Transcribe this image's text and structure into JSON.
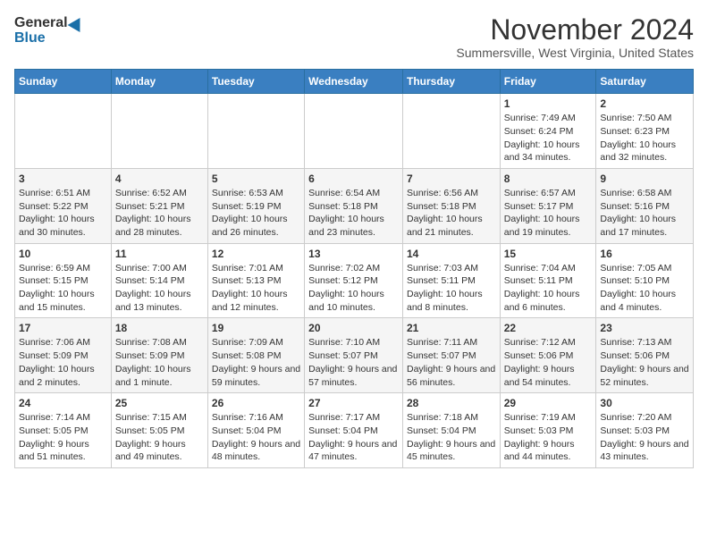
{
  "logo": {
    "general": "General",
    "blue": "Blue"
  },
  "title": "November 2024",
  "subtitle": "Summersville, West Virginia, United States",
  "weekdays": [
    "Sunday",
    "Monday",
    "Tuesday",
    "Wednesday",
    "Thursday",
    "Friday",
    "Saturday"
  ],
  "weeks": [
    [
      {
        "day": "",
        "info": ""
      },
      {
        "day": "",
        "info": ""
      },
      {
        "day": "",
        "info": ""
      },
      {
        "day": "",
        "info": ""
      },
      {
        "day": "",
        "info": ""
      },
      {
        "day": "1",
        "info": "Sunrise: 7:49 AM\nSunset: 6:24 PM\nDaylight: 10 hours and 34 minutes."
      },
      {
        "day": "2",
        "info": "Sunrise: 7:50 AM\nSunset: 6:23 PM\nDaylight: 10 hours and 32 minutes."
      }
    ],
    [
      {
        "day": "3",
        "info": "Sunrise: 6:51 AM\nSunset: 5:22 PM\nDaylight: 10 hours and 30 minutes."
      },
      {
        "day": "4",
        "info": "Sunrise: 6:52 AM\nSunset: 5:21 PM\nDaylight: 10 hours and 28 minutes."
      },
      {
        "day": "5",
        "info": "Sunrise: 6:53 AM\nSunset: 5:19 PM\nDaylight: 10 hours and 26 minutes."
      },
      {
        "day": "6",
        "info": "Sunrise: 6:54 AM\nSunset: 5:18 PM\nDaylight: 10 hours and 23 minutes."
      },
      {
        "day": "7",
        "info": "Sunrise: 6:56 AM\nSunset: 5:18 PM\nDaylight: 10 hours and 21 minutes."
      },
      {
        "day": "8",
        "info": "Sunrise: 6:57 AM\nSunset: 5:17 PM\nDaylight: 10 hours and 19 minutes."
      },
      {
        "day": "9",
        "info": "Sunrise: 6:58 AM\nSunset: 5:16 PM\nDaylight: 10 hours and 17 minutes."
      }
    ],
    [
      {
        "day": "10",
        "info": "Sunrise: 6:59 AM\nSunset: 5:15 PM\nDaylight: 10 hours and 15 minutes."
      },
      {
        "day": "11",
        "info": "Sunrise: 7:00 AM\nSunset: 5:14 PM\nDaylight: 10 hours and 13 minutes."
      },
      {
        "day": "12",
        "info": "Sunrise: 7:01 AM\nSunset: 5:13 PM\nDaylight: 10 hours and 12 minutes."
      },
      {
        "day": "13",
        "info": "Sunrise: 7:02 AM\nSunset: 5:12 PM\nDaylight: 10 hours and 10 minutes."
      },
      {
        "day": "14",
        "info": "Sunrise: 7:03 AM\nSunset: 5:11 PM\nDaylight: 10 hours and 8 minutes."
      },
      {
        "day": "15",
        "info": "Sunrise: 7:04 AM\nSunset: 5:11 PM\nDaylight: 10 hours and 6 minutes."
      },
      {
        "day": "16",
        "info": "Sunrise: 7:05 AM\nSunset: 5:10 PM\nDaylight: 10 hours and 4 minutes."
      }
    ],
    [
      {
        "day": "17",
        "info": "Sunrise: 7:06 AM\nSunset: 5:09 PM\nDaylight: 10 hours and 2 minutes."
      },
      {
        "day": "18",
        "info": "Sunrise: 7:08 AM\nSunset: 5:09 PM\nDaylight: 10 hours and 1 minute."
      },
      {
        "day": "19",
        "info": "Sunrise: 7:09 AM\nSunset: 5:08 PM\nDaylight: 9 hours and 59 minutes."
      },
      {
        "day": "20",
        "info": "Sunrise: 7:10 AM\nSunset: 5:07 PM\nDaylight: 9 hours and 57 minutes."
      },
      {
        "day": "21",
        "info": "Sunrise: 7:11 AM\nSunset: 5:07 PM\nDaylight: 9 hours and 56 minutes."
      },
      {
        "day": "22",
        "info": "Sunrise: 7:12 AM\nSunset: 5:06 PM\nDaylight: 9 hours and 54 minutes."
      },
      {
        "day": "23",
        "info": "Sunrise: 7:13 AM\nSunset: 5:06 PM\nDaylight: 9 hours and 52 minutes."
      }
    ],
    [
      {
        "day": "24",
        "info": "Sunrise: 7:14 AM\nSunset: 5:05 PM\nDaylight: 9 hours and 51 minutes."
      },
      {
        "day": "25",
        "info": "Sunrise: 7:15 AM\nSunset: 5:05 PM\nDaylight: 9 hours and 49 minutes."
      },
      {
        "day": "26",
        "info": "Sunrise: 7:16 AM\nSunset: 5:04 PM\nDaylight: 9 hours and 48 minutes."
      },
      {
        "day": "27",
        "info": "Sunrise: 7:17 AM\nSunset: 5:04 PM\nDaylight: 9 hours and 47 minutes."
      },
      {
        "day": "28",
        "info": "Sunrise: 7:18 AM\nSunset: 5:04 PM\nDaylight: 9 hours and 45 minutes."
      },
      {
        "day": "29",
        "info": "Sunrise: 7:19 AM\nSunset: 5:03 PM\nDaylight: 9 hours and 44 minutes."
      },
      {
        "day": "30",
        "info": "Sunrise: 7:20 AM\nSunset: 5:03 PM\nDaylight: 9 hours and 43 minutes."
      }
    ]
  ]
}
